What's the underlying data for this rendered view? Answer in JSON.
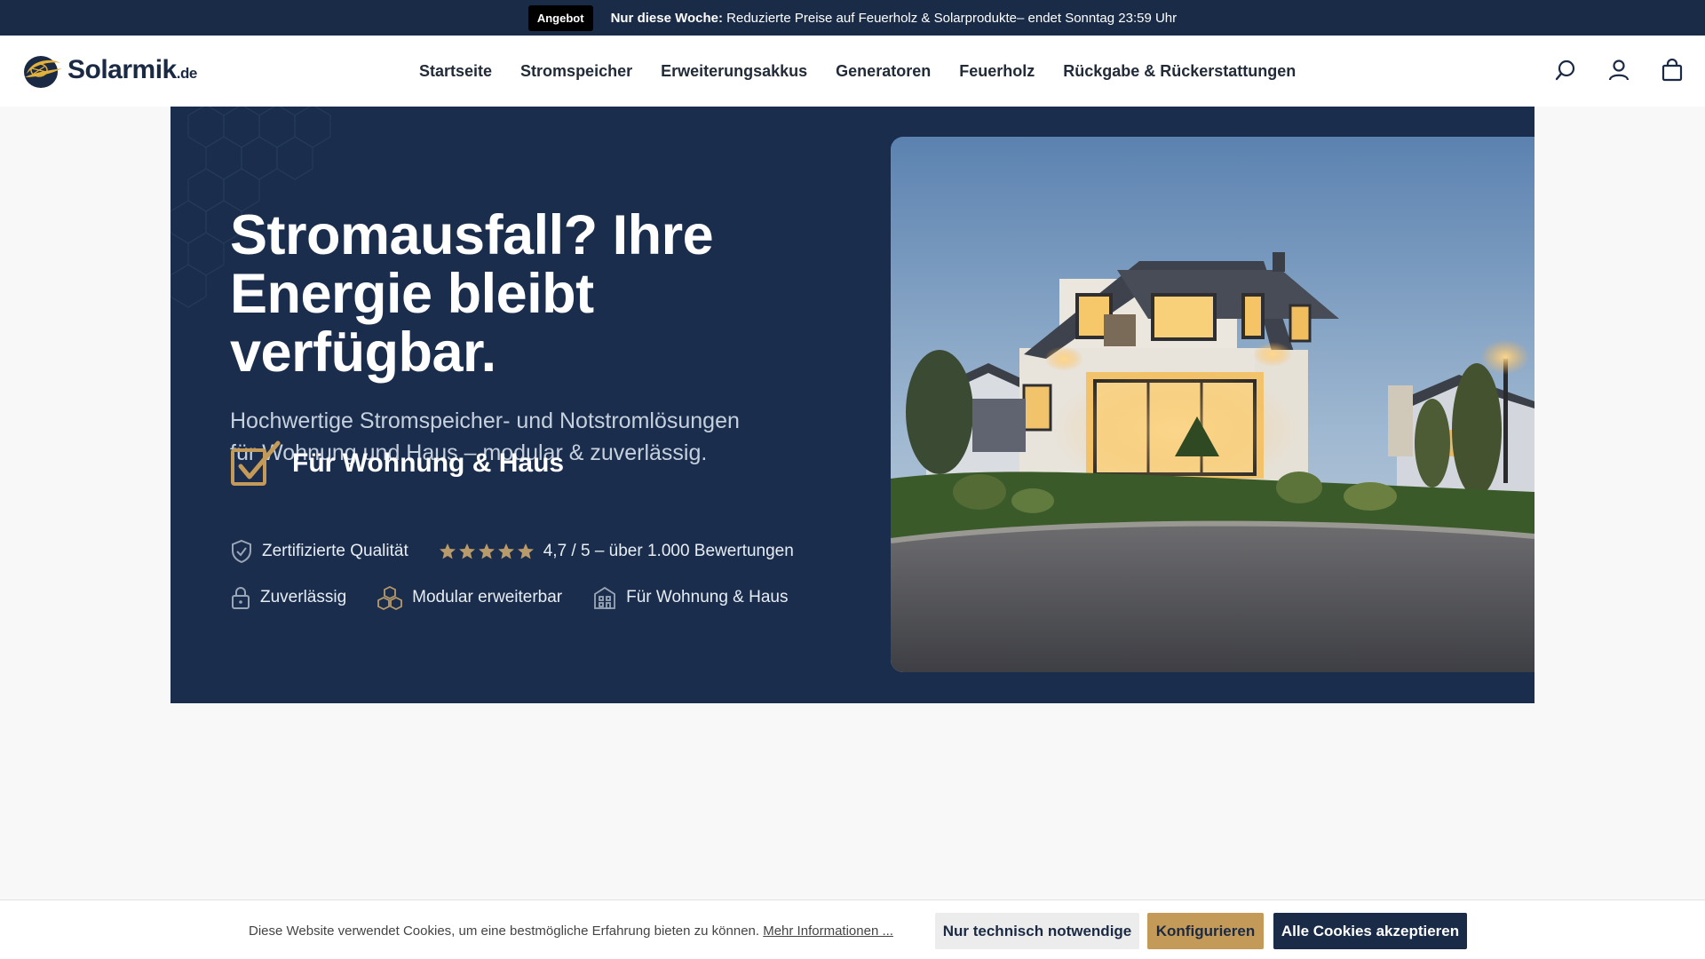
{
  "announcement": {
    "badge": "Angebot",
    "highlight": "Nur diese Woche:",
    "text": " Reduzierte Preise auf Feuerholz & Solarprodukte– endet Sonntag 23:59 Uhr"
  },
  "header": {
    "logo_text": "Solarmik",
    "logo_domain": ".de",
    "nav": [
      {
        "label": "Startseite"
      },
      {
        "label": "Stromspeicher"
      },
      {
        "label": "Erweiterungsakkus"
      },
      {
        "label": "Generatoren"
      },
      {
        "label": "Feuerholz"
      },
      {
        "label": "Rückgabe & Rückerstattungen"
      }
    ],
    "icons": [
      "search-icon",
      "account-icon",
      "cart-icon"
    ]
  },
  "hero": {
    "title_line1": "Stromausfall? Ihre",
    "title_line2": "Energie bleibt verfügbar.",
    "subtitle_line1": "Hochwertige Stromspeicher- und Notstromlösungen",
    "subtitle_line2": "für Wohnung und Haus – modular & zuverlässig.",
    "feature_main": "Für Wohnung & Haus",
    "trust": {
      "quality": "Zertifizierte Qualität",
      "rating_value": 5,
      "rating_text": "4,7 / 5 – über 1.000 Bewertungen",
      "reliable": "Zuverlässig",
      "modular": "Modular erweiterbar",
      "home": "Für Wohnung & Haus"
    }
  },
  "cookie": {
    "text": "Diese Website verwendet Cookies, um eine bestmögliche Erfahrung bieten zu können. ",
    "link": "Mehr Informationen ...",
    "btn_technical": "Nur technisch notwendige",
    "btn_configure": "Konfigurieren",
    "btn_accept_all": "Alle Cookies akzeptieren"
  },
  "colors": {
    "navy": "#1a2b47",
    "hero_bg": "#1a2d4c",
    "gold": "#c49a58",
    "star": "#b99a6a"
  }
}
